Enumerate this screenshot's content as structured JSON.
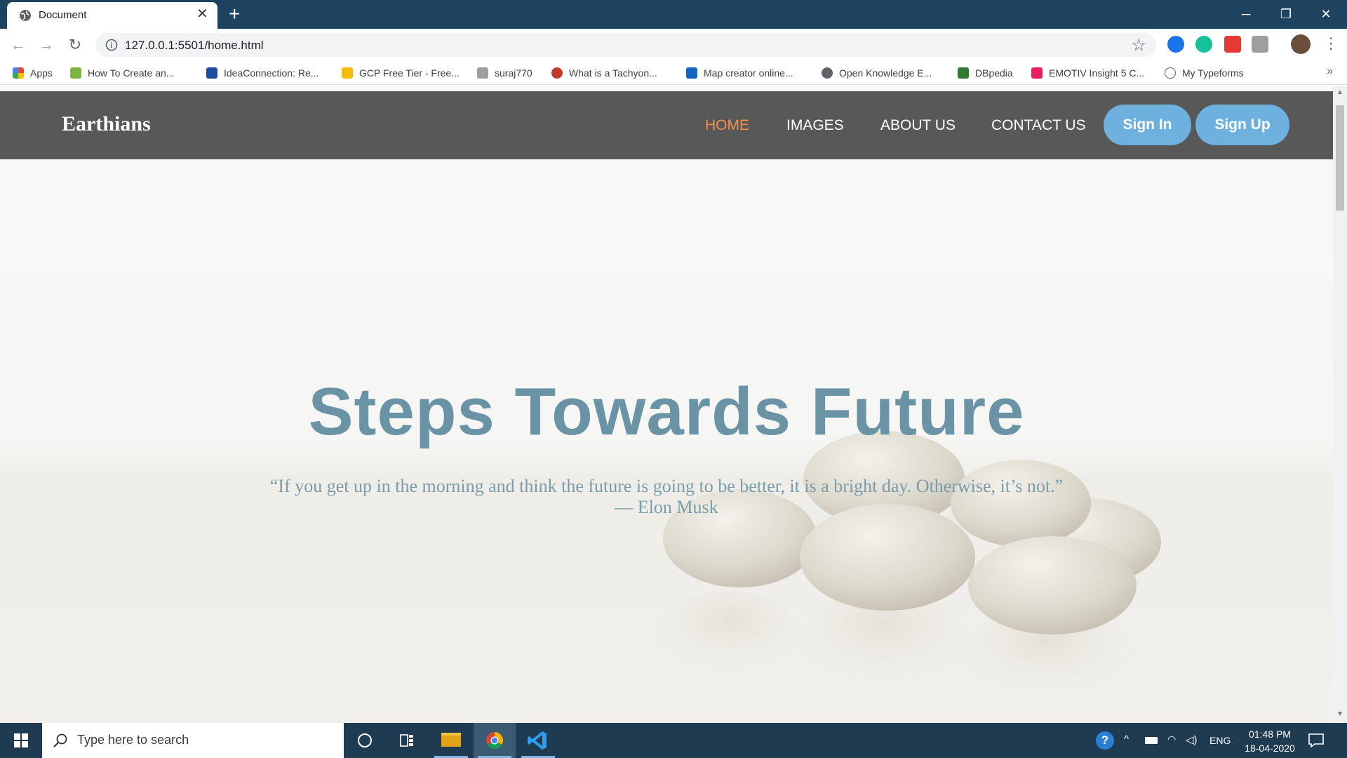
{
  "browser": {
    "tab_title": "Document",
    "tab_close": "✕",
    "new_tab": "+",
    "window_controls": {
      "minimize": "─",
      "restore": "❐",
      "close": "✕"
    },
    "nav": {
      "back": "←",
      "forward": "→",
      "reload": "↻"
    },
    "url": "127.0.0.1:5501/home.html",
    "star": "☆"
  },
  "bookmarks": [
    {
      "label": "Apps",
      "color": "#ea4335"
    },
    {
      "label": "How To Create an...",
      "color": "#7cb342"
    },
    {
      "label": "IdeaConnection: Re...",
      "color": "#1e4b9b"
    },
    {
      "label": "GCP Free Tier - Free...",
      "color": "#fbbc05"
    },
    {
      "label": "suraj770",
      "color": "#9e9e9e"
    },
    {
      "label": "What is a Tachyon...",
      "color": "#c0392b"
    },
    {
      "label": "Map creator online...",
      "color": "#1565c0"
    },
    {
      "label": "Open Knowledge E...",
      "color": "#5f6368"
    },
    {
      "label": "DBpedia",
      "color": "#2e7d32"
    },
    {
      "label": "EMOTIV Insight 5 C...",
      "color": "#e91e63"
    },
    {
      "label": "My Typeforms",
      "color": "#5f6368"
    }
  ],
  "bookmarks_more": "»",
  "site": {
    "brand": "Earthians",
    "nav": [
      "HOME",
      "IMAGES",
      "ABOUT US",
      "CONTACT US"
    ],
    "active_nav": "HOME",
    "sign_in": "Sign In",
    "sign_up": "Sign Up",
    "hero_title": "Steps Towards Future",
    "quote": "“If you get up in the morning and think the future is going to be better, it is a bright day. Otherwise, it’s not.”",
    "quote_author": "— Elon Musk",
    "colors": {
      "nav_bg": "#585858",
      "active": "#f0904b",
      "button": "#6fb1de",
      "title": "#6a94a6"
    }
  },
  "taskbar": {
    "search_placeholder": "Type here to search",
    "language": "ENG",
    "time": "01:48 PM",
    "date": "18-04-2020"
  }
}
